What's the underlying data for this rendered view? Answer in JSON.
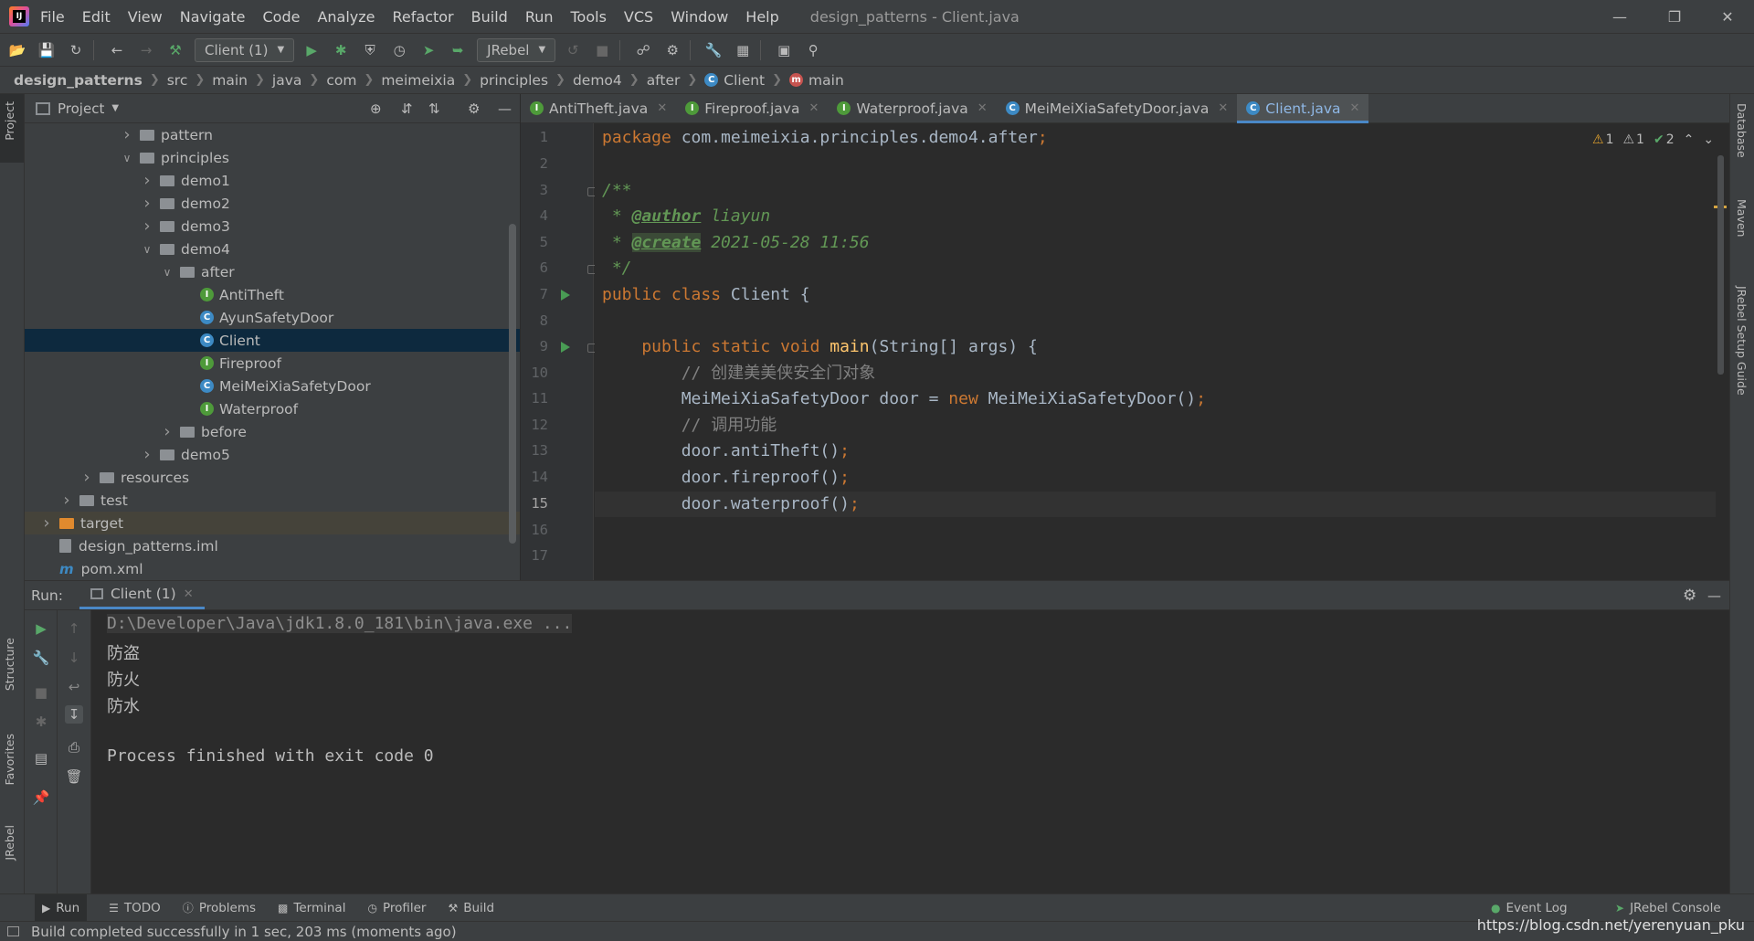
{
  "window": {
    "title": "design_patterns - Client.java",
    "menu": [
      "File",
      "Edit",
      "View",
      "Navigate",
      "Code",
      "Analyze",
      "Refactor",
      "Build",
      "Run",
      "Tools",
      "VCS",
      "Window",
      "Help"
    ]
  },
  "toolbar": {
    "run_config": "Client (1)",
    "jrebel": "JRebel"
  },
  "breadcrumb": [
    "design_patterns",
    "src",
    "main",
    "java",
    "com",
    "meimeixia",
    "principles",
    "demo4",
    "after",
    "Client",
    "main"
  ],
  "side_labels": {
    "project": "Project",
    "structure": "Structure",
    "favorites": "Favorites",
    "jrebel": "JRebel",
    "database": "Database",
    "maven": "Maven",
    "jrebel_guide": "JRebel Setup Guide"
  },
  "project": {
    "header": "Project",
    "tree": [
      {
        "label": "pattern",
        "type": "folder",
        "depth": 5,
        "expanded": false
      },
      {
        "label": "principles",
        "type": "folder",
        "depth": 5,
        "expanded": true
      },
      {
        "label": "demo1",
        "type": "folder",
        "depth": 6,
        "expanded": false
      },
      {
        "label": "demo2",
        "type": "folder",
        "depth": 6,
        "expanded": false
      },
      {
        "label": "demo3",
        "type": "folder",
        "depth": 6,
        "expanded": false
      },
      {
        "label": "demo4",
        "type": "folder",
        "depth": 6,
        "expanded": true
      },
      {
        "label": "after",
        "type": "folder",
        "depth": 7,
        "expanded": true
      },
      {
        "label": "AntiTheft",
        "type": "interface",
        "depth": 8
      },
      {
        "label": "AyunSafetyDoor",
        "type": "class",
        "depth": 8
      },
      {
        "label": "Client",
        "type": "class",
        "depth": 8,
        "selected": true
      },
      {
        "label": "Fireproof",
        "type": "interface",
        "depth": 8
      },
      {
        "label": "MeiMeiXiaSafetyDoor",
        "type": "class",
        "depth": 8
      },
      {
        "label": "Waterproof",
        "type": "interface",
        "depth": 8
      },
      {
        "label": "before",
        "type": "folder",
        "depth": 7,
        "expanded": false
      },
      {
        "label": "demo5",
        "type": "folder",
        "depth": 6,
        "expanded": false
      },
      {
        "label": "resources",
        "type": "folder",
        "depth": 3,
        "expanded": false
      },
      {
        "label": "test",
        "type": "folder",
        "depth": 2,
        "expanded": false
      },
      {
        "label": "target",
        "type": "folder-orange",
        "depth": 1,
        "expanded": false,
        "highlight": true
      },
      {
        "label": "design_patterns.iml",
        "type": "file",
        "depth": 1
      },
      {
        "label": "pom.xml",
        "type": "maven",
        "depth": 1
      }
    ]
  },
  "editor": {
    "tabs": [
      {
        "label": "AntiTheft.java",
        "icon": "interface"
      },
      {
        "label": "Fireproof.java",
        "icon": "interface"
      },
      {
        "label": "Waterproof.java",
        "icon": "interface"
      },
      {
        "label": "MeiMeiXiaSafetyDoor.java",
        "icon": "class"
      },
      {
        "label": "Client.java",
        "icon": "class",
        "active": true
      }
    ],
    "inspections": {
      "warn1": "1",
      "warn2": "1",
      "ok": "2"
    },
    "current_line": 15,
    "line_numbers": [
      "1",
      "2",
      "3",
      "4",
      "5",
      "6",
      "7",
      "8",
      "9",
      "10",
      "11",
      "12",
      "13",
      "14",
      "15",
      "16",
      "17"
    ],
    "code": {
      "l1_kw": "package ",
      "l1_pkg": "com.meimeixia.principles.demo4.after",
      "l1_semi": ";",
      "l3": "/**",
      "l4_star": " * ",
      "l4_tag": "@author",
      "l4_val": " liayun",
      "l5_star": " * ",
      "l5_tag": "@create",
      "l5_val": " 2021-05-28 11:56",
      "l6": " */",
      "l7_kw": "public class ",
      "l7_name": "Client {",
      "l9_kw": "    public static void ",
      "l9_fn": "main",
      "l9_rest": "(String[] args) {",
      "l10": "        // 创建美美侠安全门对象",
      "l11_a": "        MeiMeiXiaSafetyDoor door = ",
      "l11_kw": "new ",
      "l11_b": "MeiMeiXiaSafetyDoor()",
      "l11_semi": ";",
      "l12": "        // 调用功能",
      "l13": "        door.antiTheft()",
      "l14": "        door.fireproof()",
      "l15": "        door.waterproof()",
      "semi": ";"
    }
  },
  "run": {
    "label": "Run:",
    "tab": "Client (1)",
    "output": [
      "D:\\Developer\\Java\\jdk1.8.0_181\\bin\\java.exe ...",
      "防盗",
      "防火",
      "防水",
      "",
      "Process finished with exit code 0"
    ]
  },
  "bottom_tools": [
    "Run",
    "TODO",
    "Problems",
    "Terminal",
    "Profiler",
    "Build"
  ],
  "bottom_right": [
    "Event Log",
    "JRebel Console"
  ],
  "status": {
    "message": "Build completed successfully in 1 sec, 203 ms (moments ago)",
    "watermark": "https://blog.csdn.net/yerenyuan_pku"
  }
}
